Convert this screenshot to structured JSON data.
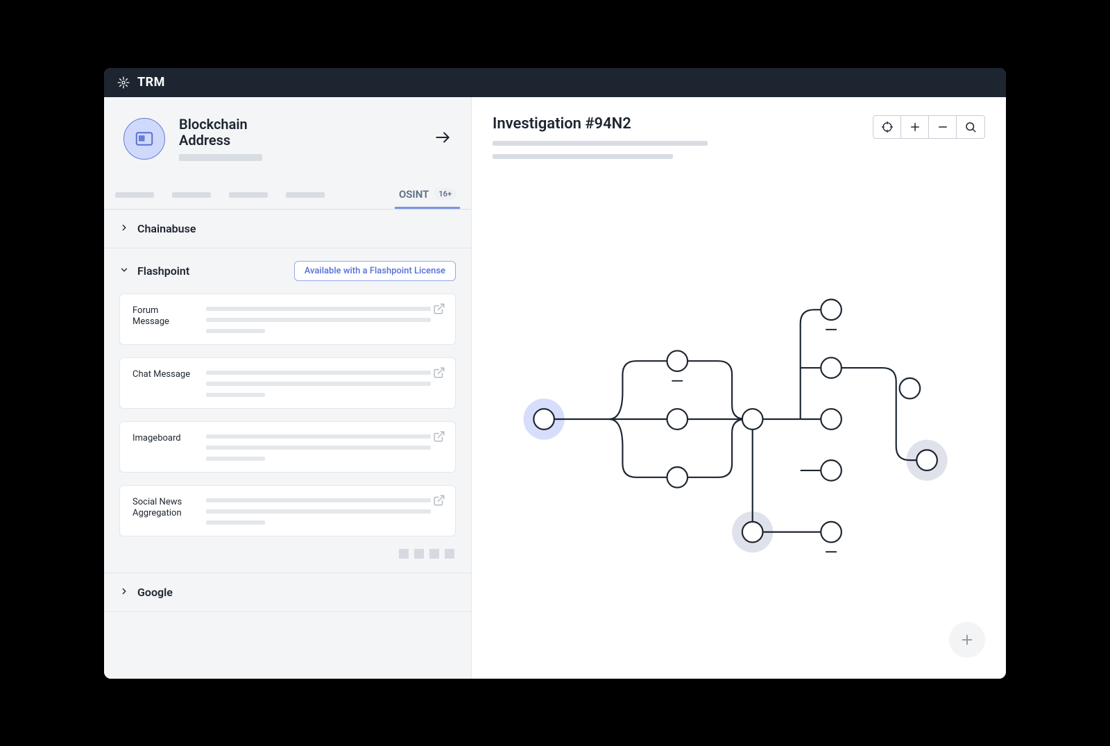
{
  "brand": {
    "name": "TRM"
  },
  "entity": {
    "title_line1": "Blockchain",
    "title_line2": "Address"
  },
  "tabs": {
    "active": {
      "label": "OSINT",
      "badge": "16+"
    }
  },
  "sections": {
    "chainabuse": {
      "title": "Chainabuse"
    },
    "flashpoint": {
      "title": "Flashpoint",
      "license_chip": "Available with a Flashpoint License",
      "items": [
        {
          "type": "Forum Message"
        },
        {
          "type": "Chat Message"
        },
        {
          "type": "Imageboard"
        },
        {
          "type": "Social News Aggregation"
        }
      ]
    },
    "google": {
      "title": "Google"
    }
  },
  "investigation": {
    "title": "Investigation #94N2"
  }
}
